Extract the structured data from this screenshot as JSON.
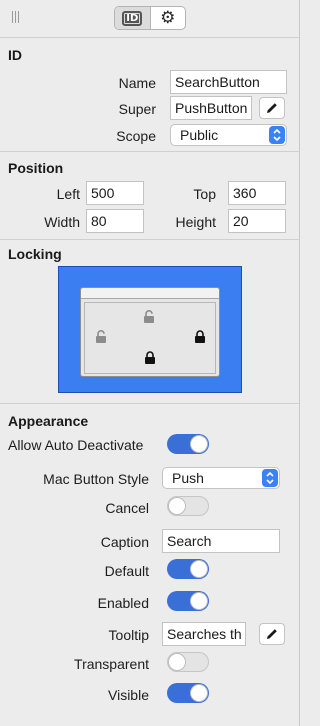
{
  "header": {
    "tabs": [
      {
        "label": "ID",
        "icon": "id-icon",
        "active": true
      },
      {
        "label": "",
        "icon": "gear-icon",
        "active": false
      }
    ]
  },
  "id_section": {
    "title": "ID",
    "name_label": "Name",
    "name_value": "SearchButton",
    "super_label": "Super",
    "super_value": "PushButton",
    "scope_label": "Scope",
    "scope_value": "Public"
  },
  "position_section": {
    "title": "Position",
    "left_label": "Left",
    "left_value": "500",
    "top_label": "Top",
    "top_value": "360",
    "width_label": "Width",
    "width_value": "80",
    "height_label": "Height",
    "height_value": "20"
  },
  "locking_section": {
    "title": "Locking",
    "locks": {
      "left": false,
      "top": false,
      "right": true,
      "bottom": true
    }
  },
  "appearance_section": {
    "title": "Appearance",
    "allow_auto_deactivate_label": "Allow Auto Deactivate",
    "allow_auto_deactivate": true,
    "mac_button_style_label": "Mac Button Style",
    "mac_button_style_value": "Push",
    "cancel_label": "Cancel",
    "cancel": false,
    "caption_label": "Caption",
    "caption_value": "Search",
    "default_label": "Default",
    "default": true,
    "enabled_label": "Enabled",
    "enabled": true,
    "tooltip_label": "Tooltip",
    "tooltip_value": "Searches th",
    "transparent_label": "Transparent",
    "transparent": false,
    "visible_label": "Visible",
    "visible": true
  },
  "colors": {
    "accent": "#3a6fd8",
    "locking_background": "#3b7ef2",
    "panel_background": "#ececec"
  }
}
